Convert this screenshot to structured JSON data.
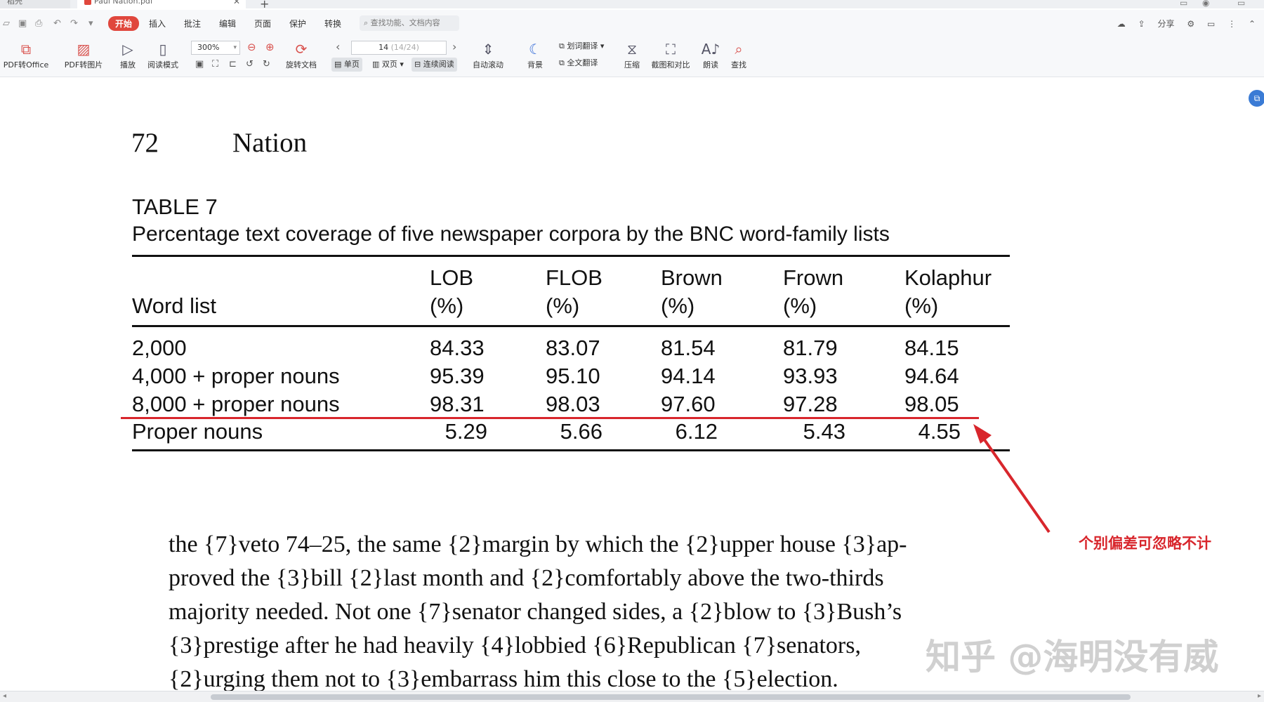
{
  "tabs": [
    {
      "label": "稻壳"
    },
    {
      "label": "Paul Nation.pdf"
    }
  ],
  "menu": {
    "items": [
      "开始",
      "插入",
      "批注",
      "编辑",
      "页面",
      "保护",
      "转换"
    ],
    "search_placeholder": "查找功能、文档内容",
    "share": "分享"
  },
  "ribbon": {
    "pdf_to_office": "PDF转Office",
    "pdf_to_image": "PDF转图片",
    "play": "播放",
    "read_mode": "阅读模式",
    "zoom": "300%",
    "rotate": "旋转文档",
    "page_current": "14",
    "page_total": "(14/24)",
    "single": "单页",
    "double": "双页",
    "continuous": "连续阅读",
    "auto_scroll": "自动滚动",
    "background": "背景",
    "word_translate": "划词翻译",
    "full_translate": "全文翻译",
    "compress": "压缩",
    "screenshot_compare": "截图和对比",
    "read_aloud": "朗读",
    "find": "查找"
  },
  "document": {
    "page_number": "72",
    "running_head": "Nation",
    "table_number": "TABLE 7",
    "table_caption": "Percentage text coverage of five newspaper corpora by the BNC word-family lists",
    "table": {
      "col0": "Word list",
      "headers": [
        {
          "name": "LOB",
          "unit": "(%)"
        },
        {
          "name": "FLOB",
          "unit": "(%)"
        },
        {
          "name": "Brown",
          "unit": "(%)"
        },
        {
          "name": "Frown",
          "unit": "(%)"
        },
        {
          "name": "Kolaphur",
          "unit": "(%)"
        }
      ],
      "rows": [
        {
          "label": "2,000",
          "values": [
            "84.33",
            "83.07",
            "81.54",
            "81.79",
            "84.15"
          ]
        },
        {
          "label": "4,000 + proper nouns",
          "values": [
            "95.39",
            "95.10",
            "94.14",
            "93.93",
            "94.64"
          ]
        },
        {
          "label": "8,000 + proper nouns",
          "values": [
            "98.31",
            "98.03",
            "97.60",
            "97.28",
            "98.05"
          ]
        },
        {
          "label": "Proper nouns",
          "values": [
            "5.29",
            "5.66",
            "6.12",
            "5.43",
            "4.55"
          ]
        }
      ]
    },
    "body_lines": [
      "the {7}veto 74–25, the same {2}margin by which the {2}upper house {3}ap-",
      "proved the {3}bill {2}last month and {2}comfortably above the two-thirds",
      "majority needed. Not one {7}senator changed sides, a {2}blow to {3}Bush’s",
      "{3}prestige after he had heavily {4}lobbied {6}Republican {7}senators,",
      "{2}urging them not to {3}embarrass him this close to the {5}election."
    ]
  },
  "annotation": {
    "note": "个别偏差可忽略不计",
    "color": "#d8262c"
  },
  "watermark": "知乎 @海明没有威"
}
